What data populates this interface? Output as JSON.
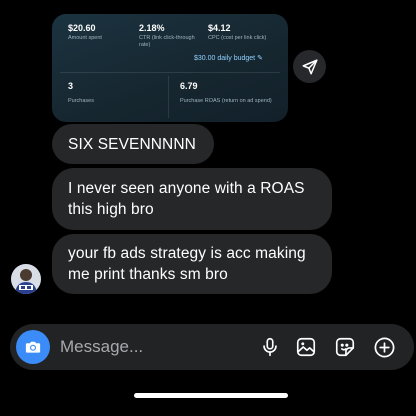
{
  "ad_card": {
    "amount_spent": {
      "value": "$20.60",
      "label": "Amount spent"
    },
    "ctr": {
      "value": "2.18%",
      "label": "CTR (link click-through rate)"
    },
    "cpc": {
      "value": "$4.12",
      "label": "CPC (cost per link click)"
    },
    "budget": "$30.00 daily budget",
    "purchases": {
      "value": "3",
      "label": "Purchases"
    },
    "roas": {
      "value": "6.79",
      "label": "Purchase ROAS (return on ad spend)"
    }
  },
  "messages": [
    {
      "text": "SIX SEVENNNNN"
    },
    {
      "text": "I never seen anyone with a ROAS this high bro"
    },
    {
      "text": "your fb ads strategy is acc making me print thanks sm bro"
    }
  ],
  "composer": {
    "placeholder": "Message..."
  },
  "icons": {
    "share": "send-icon",
    "camera": "camera-icon",
    "mic": "microphone-icon",
    "gallery": "image-icon",
    "sticker": "sticker-icon",
    "add": "plus-circle-icon"
  },
  "colors": {
    "camera_button": "#3b8cf8",
    "bubble": "#262729",
    "budget_link": "#8fd2ff"
  }
}
